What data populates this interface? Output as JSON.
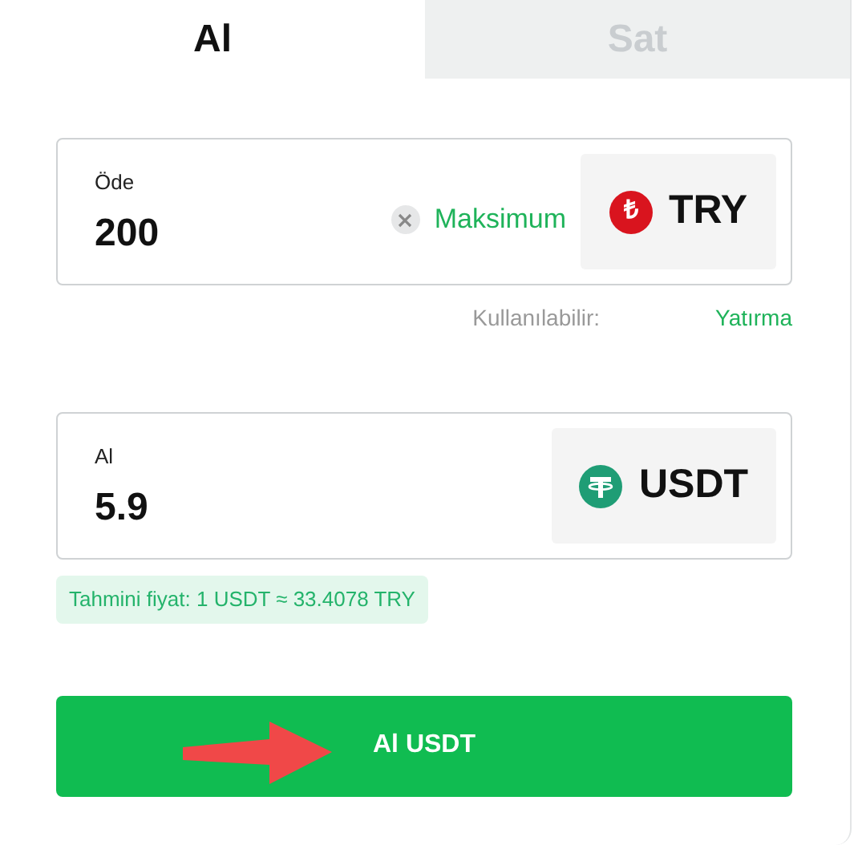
{
  "tabs": [
    {
      "label": "Al",
      "selected": true
    },
    {
      "label": "Sat",
      "selected": false
    }
  ],
  "fields": [
    {
      "label": "Öde",
      "value": "200",
      "clearable": true,
      "action": "Maksimum",
      "currency": {
        "code": "TRY",
        "symbol": "₺",
        "kind": "try"
      }
    },
    {
      "label": "Al",
      "value": "5.9",
      "clearable": false,
      "currency": {
        "code": "USDT",
        "kind": "usdt"
      }
    }
  ],
  "balance": {
    "label": "Kullanılabilir:",
    "action": "Yatırma"
  },
  "estimate": "Tahmini fiyat: 1 USDT ≈ 33.4078 TRY",
  "submit": "Al USDT"
}
